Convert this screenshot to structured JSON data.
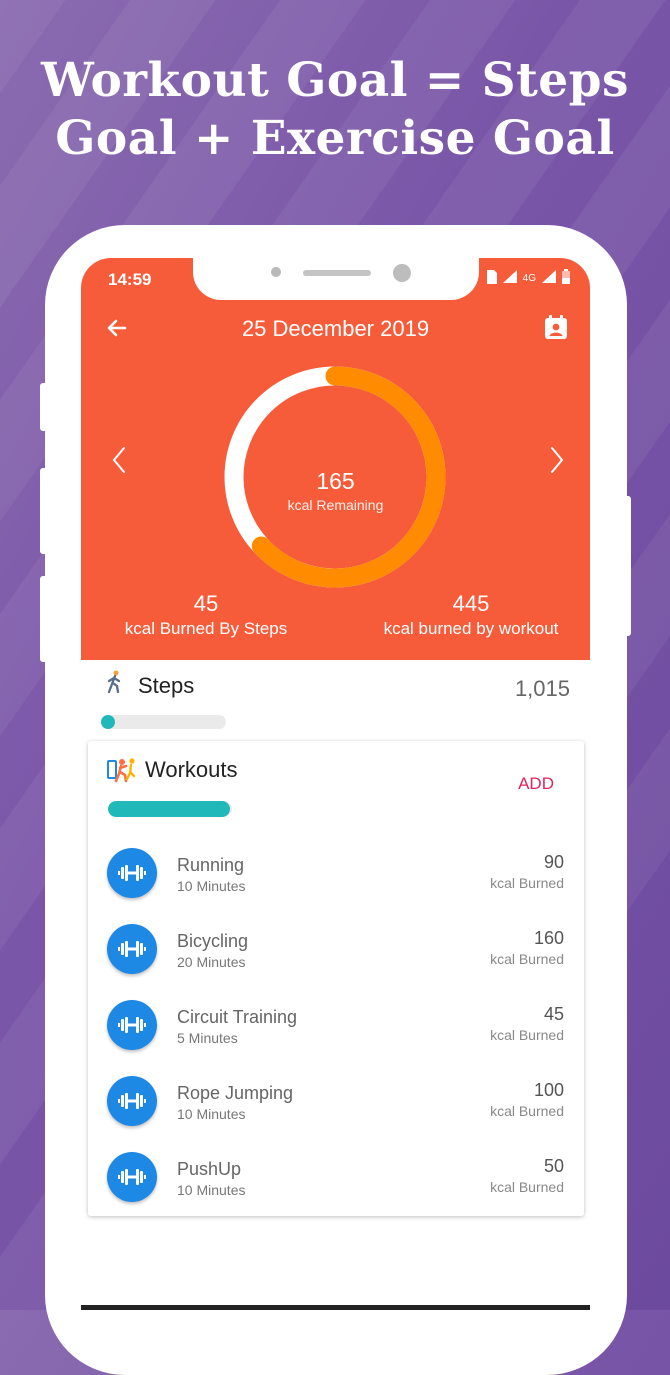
{
  "banner": {
    "line1": "Workout Goal  = Steps",
    "line2": "Goal + Exercise Goal"
  },
  "status_bar": {
    "time": "14:59",
    "network_label": "4G"
  },
  "header": {
    "date": "25 December 2019"
  },
  "ring": {
    "value": "165",
    "label": "kcal Remaining",
    "progress_fraction": 0.63,
    "colors": {
      "track": "#ffffff",
      "progress": "#ff8c00"
    }
  },
  "stats": {
    "steps_value": "45",
    "steps_label": "kcal Burned By Steps",
    "workout_value": "445",
    "workout_label": "kcal burned by workout"
  },
  "steps": {
    "title": "Steps",
    "count": "1,015",
    "progress_fraction": 0.1
  },
  "workouts": {
    "title": "Workouts",
    "add_label": "ADD",
    "progress_fraction": 0.98,
    "items": [
      {
        "name": "Running",
        "duration": "10 Minutes",
        "kcal": "90",
        "unit": "kcal Burned"
      },
      {
        "name": "Bicycling",
        "duration": "20 Minutes",
        "kcal": "160",
        "unit": "kcal Burned"
      },
      {
        "name": "Circuit Training",
        "duration": "5 Minutes",
        "kcal": "45",
        "unit": "kcal Burned"
      },
      {
        "name": "Rope Jumping",
        "duration": "10 Minutes",
        "kcal": "100",
        "unit": "kcal Burned"
      },
      {
        "name": "PushUp",
        "duration": "10 Minutes",
        "kcal": "50",
        "unit": "kcal Burned"
      }
    ]
  },
  "colors": {
    "hero": "#f65c3a",
    "accent_teal": "#21b8b9",
    "add_pink": "#e0245e",
    "workout_icon_blue": "#1e88e5",
    "background_purple": "#7a56a8"
  },
  "icons": {
    "back": "back-arrow-icon",
    "calendar": "calendar-person-icon",
    "prev": "chevron-left-icon",
    "next": "chevron-right-icon",
    "steps": "walking-person-icon",
    "workouts": "exercise-people-icon",
    "workout_item": "dumbbell-icon"
  }
}
